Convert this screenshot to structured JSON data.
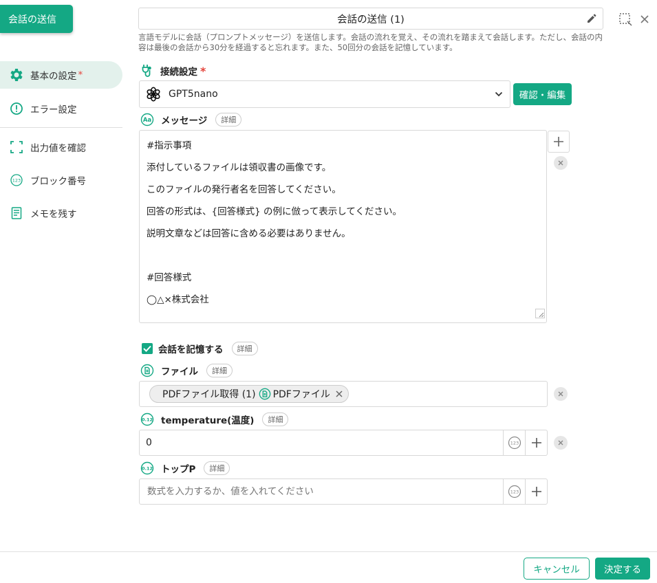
{
  "block_tag": "会話の送信",
  "sidebar": {
    "items": [
      {
        "label": "基本の設定",
        "required": "*"
      },
      {
        "label": "エラー設定"
      },
      {
        "label": "出力値を確認"
      },
      {
        "label": "ブロック番号"
      },
      {
        "label": "メモを残す"
      }
    ]
  },
  "header": {
    "title": "会話の送信 (1)",
    "description": "言語モデルに会話（プロンプトメッセージ）を送信します。会話の流れを覚え、その流れを踏まえて会話します。ただし、会話の内容は最後の会話から30分を経過すると忘れます。また、50回分の会話を記憶しています。"
  },
  "connection": {
    "label": "接続設定",
    "required": "*",
    "model": "GPT5nano",
    "confirm_button": "確認・編集"
  },
  "message": {
    "label": "メッセージ",
    "detail": "詳細",
    "lines": [
      "#指示事項",
      "添付しているファイルは領収書の画像です。",
      "このファイルの発行者名を回答してください。",
      "回答の形式は、{回答様式} の例に倣って表示してください。",
      "説明文章などは回答に含める必要はありません。",
      "",
      "#回答様式",
      "◯△×株式会社"
    ]
  },
  "remember": {
    "label": "会話を記憶する",
    "detail": "詳細",
    "checked": true
  },
  "file": {
    "label": "ファイル",
    "detail": "詳細",
    "chip_source": "PDFファイル取得 (1)",
    "chip_name": "PDFファイル"
  },
  "temperature": {
    "label": "temperature(温度)",
    "detail": "詳細",
    "value": "0",
    "num_icon_text": "0.12",
    "badge_text": "123"
  },
  "top_p": {
    "label": "トップP",
    "detail": "詳細",
    "placeholder": "数式を入力するか、値を入れてください",
    "num_icon_text": "0.12",
    "badge_text": "123"
  },
  "footer": {
    "cancel": "キャンセル",
    "ok": "決定する"
  },
  "colors": {
    "accent": "#14a884",
    "required": "#e4443b"
  }
}
